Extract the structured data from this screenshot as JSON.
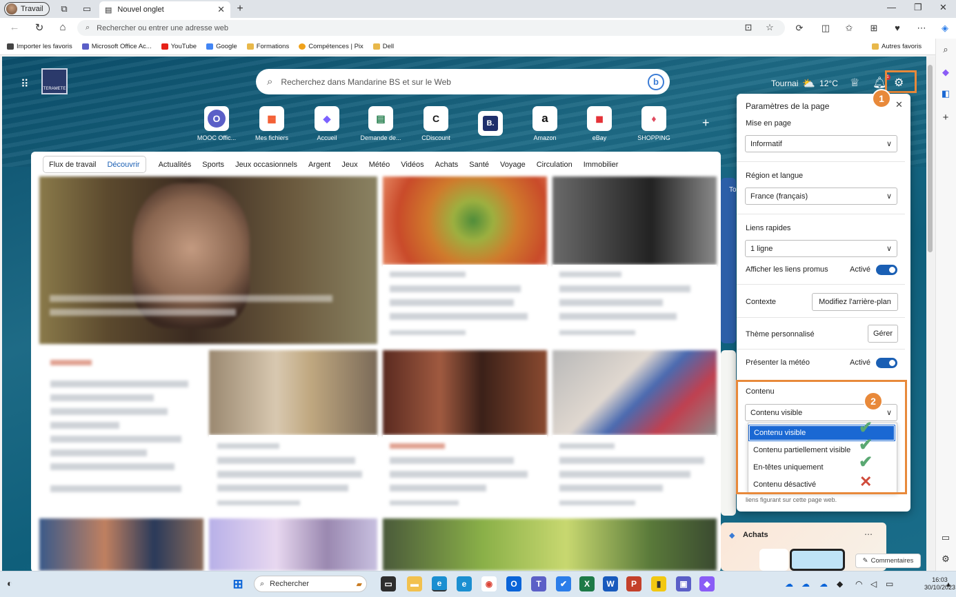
{
  "browser": {
    "profile_name": "Travail",
    "tab_title": "Nouvel onglet",
    "address_placeholder": "Rechercher ou entrer une adresse web"
  },
  "favorites": [
    {
      "label": "Importer les favoris",
      "icon": "import-icon",
      "color": "#444444"
    },
    {
      "label": "Microsoft Office Ac...",
      "icon": "office-icon",
      "color": "#5b5fc7"
    },
    {
      "label": "YouTube",
      "icon": "youtube-icon",
      "color": "#e62117"
    },
    {
      "label": "Google",
      "icon": "google-icon",
      "color": "#4285f4"
    },
    {
      "label": "Formations",
      "icon": "folder-icon",
      "color": "#e8b84a"
    },
    {
      "label": "Compétences | Pix",
      "icon": "pix-icon",
      "color": "#f0a21b"
    },
    {
      "label": "Dell",
      "icon": "folder-icon",
      "color": "#e8b84a"
    }
  ],
  "favorites_other": "Autres favoris",
  "newtab": {
    "search_placeholder": "Recherchez dans Mandarine BS et sur le Web",
    "city": "Tournai",
    "temperature": "12°C",
    "logo_text": "TERAMETE",
    "notification_count": "1"
  },
  "quick_links": [
    {
      "label": "MOOC Offic...",
      "glyph": "O",
      "color": "#5b5fc7"
    },
    {
      "label": "Mes fichiers",
      "glyph": "▦",
      "color": "#f25022"
    },
    {
      "label": "Accueil",
      "glyph": "◆",
      "color": "#7b61ff"
    },
    {
      "label": "Demande de...",
      "glyph": "▤",
      "color": "#1d7a47"
    },
    {
      "label": "CDiscount",
      "glyph": "C",
      "color": "#1b1b1b"
    },
    {
      "label": "",
      "glyph": "B.",
      "color": "#1f2f6b"
    },
    {
      "label": "Amazon",
      "glyph": "a",
      "color": "#111111"
    },
    {
      "label": "eBay",
      "glyph": "◼",
      "color": "#e53238"
    },
    {
      "label": "SHOPPING",
      "glyph": "♦",
      "color": "#e04a5f"
    }
  ],
  "feed_tabs": {
    "group": [
      "Flux de travail",
      "Découvrir"
    ],
    "items": [
      "Actualités",
      "Sports",
      "Jeux occasionnels",
      "Argent",
      "Jeux",
      "Météo",
      "Vidéos",
      "Achats",
      "Santé",
      "Voyage",
      "Circulation",
      "Immobilier"
    ]
  },
  "right_cards": {
    "shopping_title": "Achats",
    "weather_prefix": "To"
  },
  "settings": {
    "title": "Paramètres de la page",
    "layout_label": "Mise en page",
    "layout_value": "Informatif",
    "region_label": "Région et langue",
    "region_value": "France (français)",
    "quicklinks_label": "Liens rapides",
    "quicklinks_value": "1 ligne",
    "promo_label": "Afficher les liens promus",
    "promo_state": "Activé",
    "context_label": "Contexte",
    "context_button": "Modifiez l'arrière-plan",
    "theme_label": "Thème personnalisé",
    "theme_button": "Gérer",
    "weather_label": "Présenter la météo",
    "weather_state": "Activé",
    "content_label": "Contenu",
    "content_value": "Contenu visible",
    "content_options": [
      "Contenu visible",
      "Contenu partiellement visible",
      "En-têtes uniquement",
      "Contenu désactivé"
    ],
    "footer_text": "liens figurant sur cette page web."
  },
  "annotations": {
    "step1": "1",
    "step2": "2",
    "accent_color": "#e8893a"
  },
  "feedback_label": "Commentaires",
  "taskbar": {
    "search_placeholder": "Rechercher",
    "time": "16:03",
    "date": "30/10/2023"
  }
}
